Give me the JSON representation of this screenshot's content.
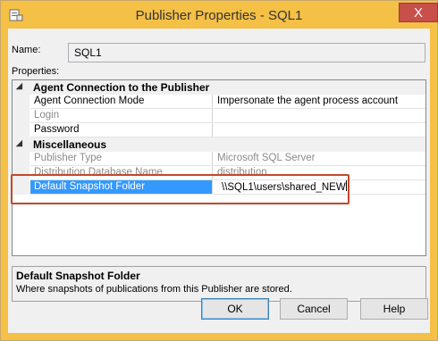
{
  "window": {
    "title": "Publisher Properties - SQL1",
    "close_label": "X"
  },
  "name_field": {
    "label": "Name:",
    "value": "SQL1"
  },
  "properties": {
    "label": "Properties:",
    "categories": [
      {
        "title": "Agent Connection to the Publisher",
        "rows": [
          {
            "name": "Agent Connection Mode",
            "value": "Impersonate the agent process account",
            "enabled": true
          },
          {
            "name": "Login",
            "value": "",
            "enabled": false
          },
          {
            "name": "Password",
            "value": "",
            "enabled": true
          }
        ]
      },
      {
        "title": "Miscellaneous",
        "rows": [
          {
            "name": "Publisher Type",
            "value": "Microsoft SQL Server",
            "enabled": false
          },
          {
            "name": "Distribution Database Name",
            "value": "distribution",
            "enabled": false
          },
          {
            "name": "Default Snapshot Folder",
            "value": "\\\\SQL1\\users\\shared_NEW",
            "enabled": true,
            "selected": true
          }
        ]
      }
    ]
  },
  "help": {
    "title": "Default Snapshot Folder",
    "description": "Where snapshots of publications from this Publisher are stored."
  },
  "buttons": {
    "ok": "OK",
    "cancel": "Cancel",
    "help": "Help"
  },
  "colors": {
    "titlebar": "#f5c046",
    "selection": "#3399ff",
    "callout": "#c0482b"
  }
}
